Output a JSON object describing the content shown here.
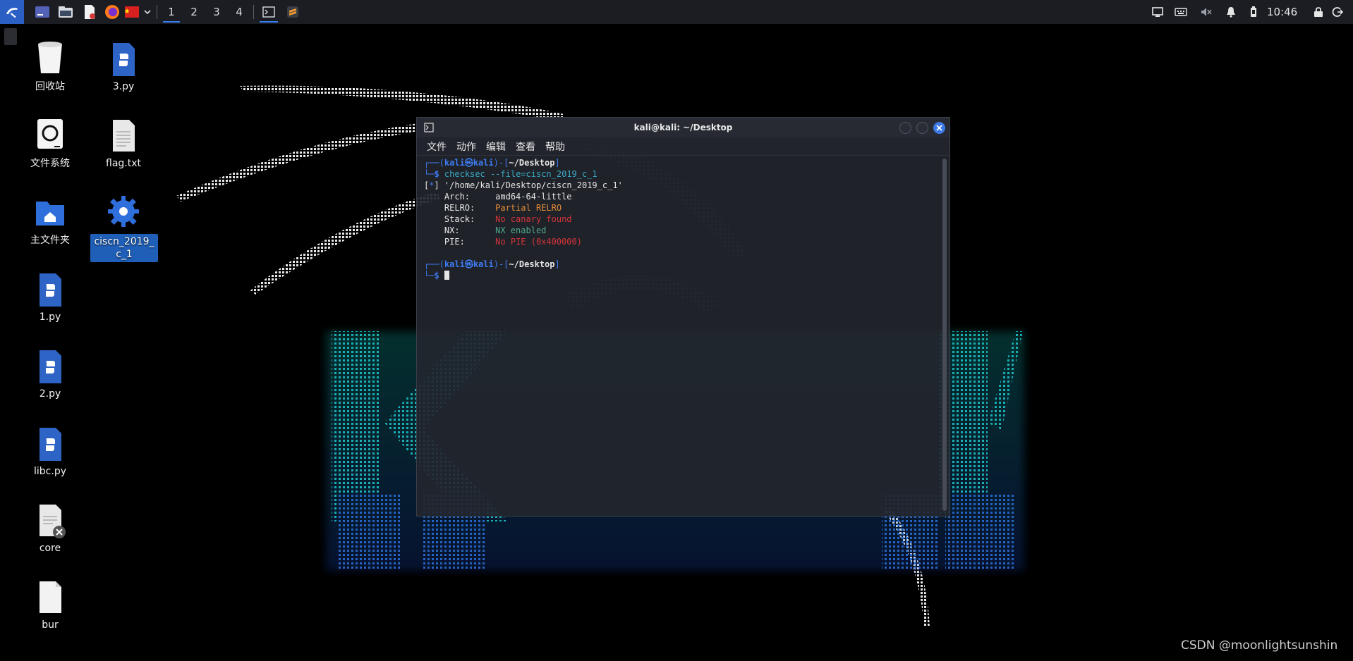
{
  "panel": {
    "workspaces": [
      "1",
      "2",
      "3",
      "4"
    ],
    "active_workspace": "1",
    "clock": "10:46",
    "accent": "#367bf0"
  },
  "desktop": {
    "icons": [
      {
        "label": "回收站",
        "icon": "trash-icon"
      },
      {
        "label": "3.py",
        "icon": "python-file-icon"
      },
      {
        "label": "文件系统",
        "icon": "disk-icon"
      },
      {
        "label": "flag.txt",
        "icon": "text-file-icon"
      },
      {
        "label": "主文件夹",
        "icon": "home-folder-icon"
      },
      {
        "label": "ciscn_2019_c_1",
        "icon": "gear-executable-icon"
      },
      {
        "label": "1.py",
        "icon": "python-file-icon"
      },
      {
        "label": "2.py",
        "icon": "python-file-icon"
      },
      {
        "label": "libc.py",
        "icon": "python-file-icon"
      },
      {
        "label": "core",
        "icon": "core-file-icon"
      },
      {
        "label": "bur",
        "icon": "blank-file-icon"
      }
    ]
  },
  "terminal": {
    "title": "kali@kali: ~/Desktop",
    "menu": [
      "文件",
      "动作",
      "编辑",
      "查看",
      "帮助"
    ],
    "prompt": {
      "corner_top": "┌──(",
      "user": "kali",
      "at": "㉿",
      "host": "kali",
      "mid": ")-[",
      "path": "~/Desktop",
      "end": "]",
      "corner_bottom": "└─",
      "dollar": "$"
    },
    "command": "checksec --file=ciscn_2019_c_1",
    "output_path": {
      "bracket_open": "[",
      "star": "*",
      "bracket_close": "] ",
      "text": "'/home/kali/Desktop/ciscn_2019_c_1'"
    },
    "rows": [
      {
        "key": "    Arch:     ",
        "value": "amd64-64-little",
        "color": "white"
      },
      {
        "key": "    RELRO:    ",
        "value": "Partial RELRO",
        "color": "orange"
      },
      {
        "key": "    Stack:    ",
        "value": "No canary found",
        "color": "red"
      },
      {
        "key": "    NX:       ",
        "value": "NX enabled",
        "color": "green"
      },
      {
        "key": "    PIE:      ",
        "value": "No PIE (0x400000)",
        "color": "red"
      }
    ]
  },
  "watermark": "CSDN @moonlightsunshin"
}
